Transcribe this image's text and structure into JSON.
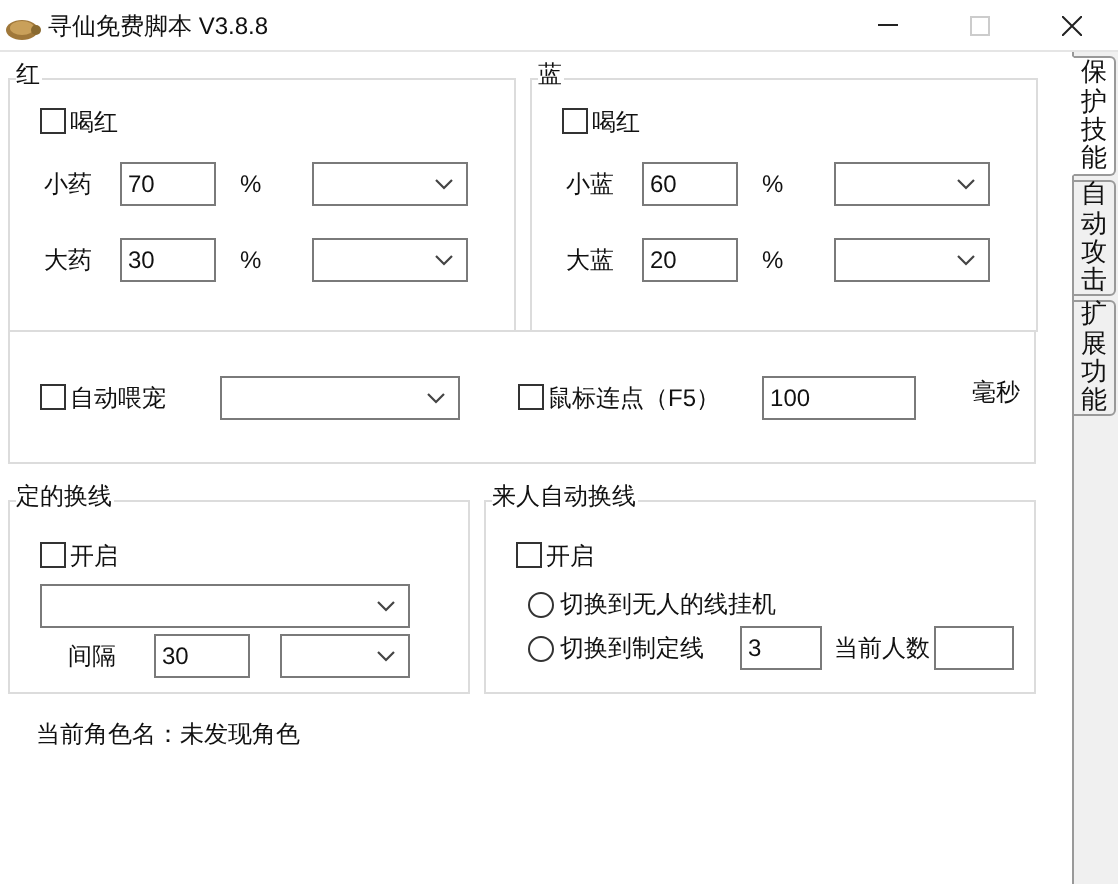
{
  "window": {
    "title": "寻仙免费脚本 V3.8.8"
  },
  "side_tabs": [
    {
      "label": "保护技能",
      "selected": true
    },
    {
      "label": "自动攻击",
      "selected": false
    },
    {
      "label": "扩展功能",
      "selected": false
    }
  ],
  "potion_groups": [
    {
      "title": "红",
      "drink": {
        "label": "喝红",
        "checked": false
      },
      "rows": [
        {
          "label": "小药",
          "value": "70",
          "unit": "%"
        },
        {
          "label": "大药",
          "value": "30",
          "unit": "%"
        }
      ]
    },
    {
      "title": "蓝",
      "drink": {
        "label": "喝红",
        "checked": false
      },
      "rows": [
        {
          "label": "小蓝",
          "value": "60",
          "unit": "%"
        },
        {
          "label": "大蓝",
          "value": "20",
          "unit": "%"
        }
      ]
    }
  ],
  "misc_group": {
    "auto_feed": {
      "label": "自动喂宠",
      "checked": false
    },
    "mouse_click": {
      "label": "鼠标连点（F5）",
      "checked": false
    },
    "click_interval": "100",
    "click_unit": "毫秒"
  },
  "timed_switch": {
    "title": "定的换线",
    "enable": {
      "label": "开启",
      "checked": false
    },
    "interval_label": "间隔",
    "interval_value": "30"
  },
  "auto_switch": {
    "title": "来人自动换线",
    "enable": {
      "label": "开启",
      "checked": false
    },
    "options": [
      {
        "label": "切换到无人的线挂机",
        "selected": false
      },
      {
        "label": "切换到制定线",
        "selected": false
      }
    ],
    "line_value": "3",
    "count_label": "当前人数"
  },
  "status": "当前角色名：未发现角色"
}
